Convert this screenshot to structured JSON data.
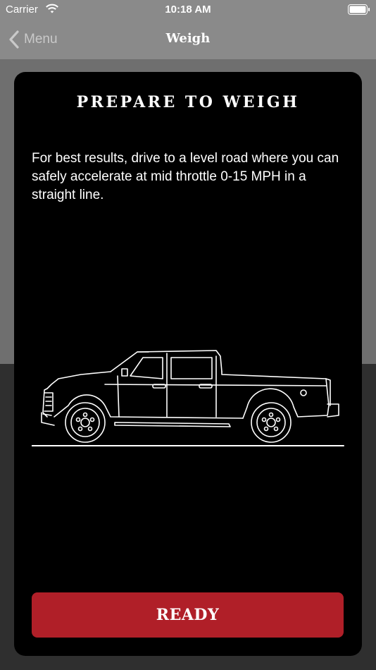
{
  "status_bar": {
    "carrier": "Carrier",
    "time": "10:18 AM"
  },
  "nav": {
    "back_label": "Menu",
    "title": "Weigh"
  },
  "card": {
    "title": "PREPARE TO WEIGH",
    "body": "For best results, drive to a level road where you can safely accelerate at mid throttle 0-15 MPH in a straight line.",
    "button_label": "READY"
  },
  "colors": {
    "card_background": "#000000",
    "button_red": "#b01f28",
    "nav_gray": "#8a8a8a"
  },
  "icons": {
    "back": "chevron-left-icon",
    "wifi": "wifi-icon",
    "battery": "battery-icon",
    "illustration": "pickup-truck-illustration"
  }
}
